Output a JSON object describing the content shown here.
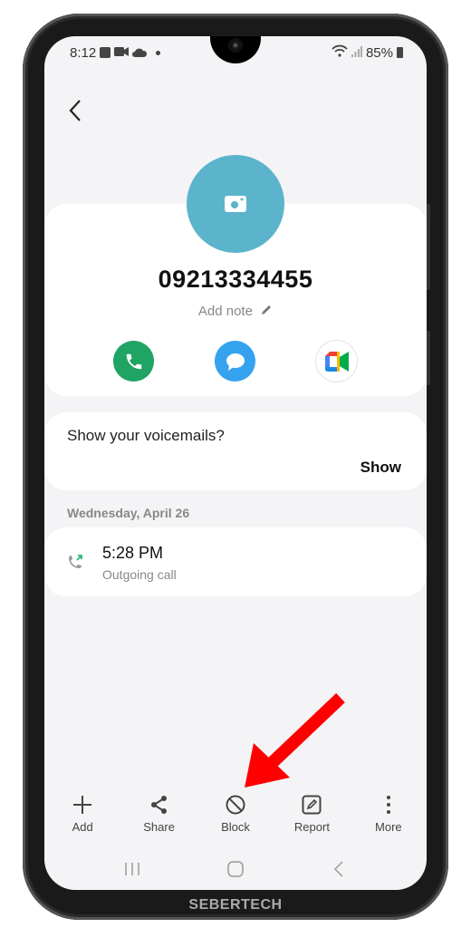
{
  "status_bar": {
    "time": "8:12",
    "left_icons": [
      "gallery-icon",
      "video-icon",
      "cloud-icon",
      "dot-icon"
    ],
    "right_icons": [
      "wifi-icon",
      "signal-icon"
    ],
    "battery": "85%"
  },
  "header": {
    "back_icon": "chevron-left-icon"
  },
  "contact": {
    "number": "09213334455",
    "add_note_label": "Add note",
    "avatar_color": "#5bb4cb",
    "actions": [
      {
        "name": "call",
        "icon": "phone-icon",
        "color": "#1fa463"
      },
      {
        "name": "message",
        "icon": "message-icon",
        "color": "#35a2f0"
      },
      {
        "name": "video-call",
        "icon": "google-meet-icon",
        "color": "#ffffff"
      }
    ]
  },
  "voicemail": {
    "prompt": "Show your voicemails?",
    "show_label": "Show"
  },
  "history": {
    "date_header": "Wednesday, April 26",
    "calls": [
      {
        "time": "5:28 PM",
        "type": "Outgoing call",
        "icon": "outgoing-call-icon"
      }
    ]
  },
  "toolbar": {
    "items": [
      {
        "label": "Add",
        "icon": "plus-icon"
      },
      {
        "label": "Share",
        "icon": "share-icon"
      },
      {
        "label": "Block",
        "icon": "block-icon"
      },
      {
        "label": "Report",
        "icon": "report-icon"
      },
      {
        "label": "More",
        "icon": "more-vertical-icon"
      }
    ]
  },
  "navigation": {
    "recents_icon": "recents-icon",
    "home_icon": "home-icon",
    "back_icon": "back-icon"
  },
  "annotation": {
    "arrow_color": "#ff0000",
    "target": "Block"
  },
  "watermark": "SEBERTECH"
}
